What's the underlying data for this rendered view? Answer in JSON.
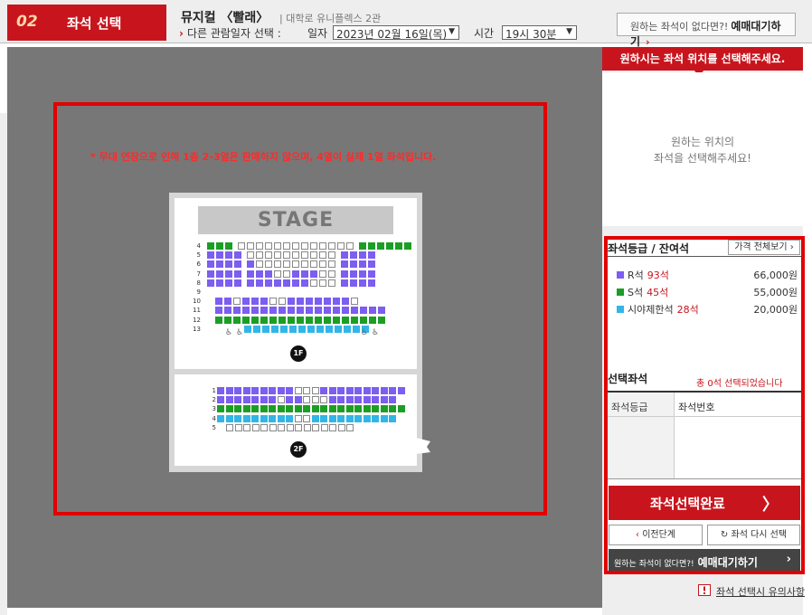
{
  "header": {
    "step_number": "02",
    "step_title": "좌석 선택",
    "show_title": "뮤지컬 〈빨래〉",
    "venue": "| 대학로 유니플렉스 2관",
    "other_date_label": "다른 관람일자 선택 :",
    "date_label": "일자",
    "date_value": "2023년 02월 16일(목)",
    "time_label": "시간",
    "time_value": "19시 30분",
    "waitlist_hint": "원하는 좌석이 없다면?!",
    "waitlist_label": "예매대기하기"
  },
  "map": {
    "notice": "*  무대 연장으로 인해 1층 2-3열은 판매하지 않으며, 4열이 실제 1열 좌석입니다.",
    "stage_label": "STAGE",
    "floor1_badge": "1F",
    "floor2_badge": "2F",
    "floor1_rows": [
      "4",
      "5",
      "6",
      "7",
      "8",
      "9",
      "10",
      "11",
      "12",
      "13"
    ],
    "floor2_rows": [
      "1",
      "2",
      "3",
      "4",
      "5"
    ]
  },
  "panel": {
    "header": "원하시는 좌석 위치를 선택해주세요.",
    "hint_line1": "원하는 위치의",
    "hint_line2": "좌석을 선택해주세요!",
    "grade_title": "좌석등급 / 잔여석",
    "price_all_button": "가격 전체보기",
    "grades": [
      {
        "name": "R석",
        "count": "93석",
        "price": "66,000원",
        "color": "#7c5ef0"
      },
      {
        "name": "S석",
        "count": "45석",
        "price": "55,000원",
        "color": "#1c9e25"
      },
      {
        "name": "시야제한석",
        "count": "28석",
        "price": "20,000원",
        "color": "#33b5e6"
      }
    ],
    "selected_title": "선택좌석",
    "selected_count": "총 0석 선택되었습니다",
    "col_grade": "좌석등급",
    "col_seat": "좌석번호",
    "complete_button": "좌석선택완료",
    "prev_button": "이전단계",
    "reset_button": "좌석 다시 선택",
    "waitlist_hint": "원하는 좌석이 없다면?!",
    "waitlist_label": "예매대기하기",
    "caution_link": "좌석 선택시 유의사항"
  },
  "colors": {
    "brand_red": "#c8151d",
    "frame_red": "#e00000",
    "seat_r": "#7c5ef0",
    "seat_s": "#1c9e25",
    "seat_view": "#33b5e6"
  }
}
